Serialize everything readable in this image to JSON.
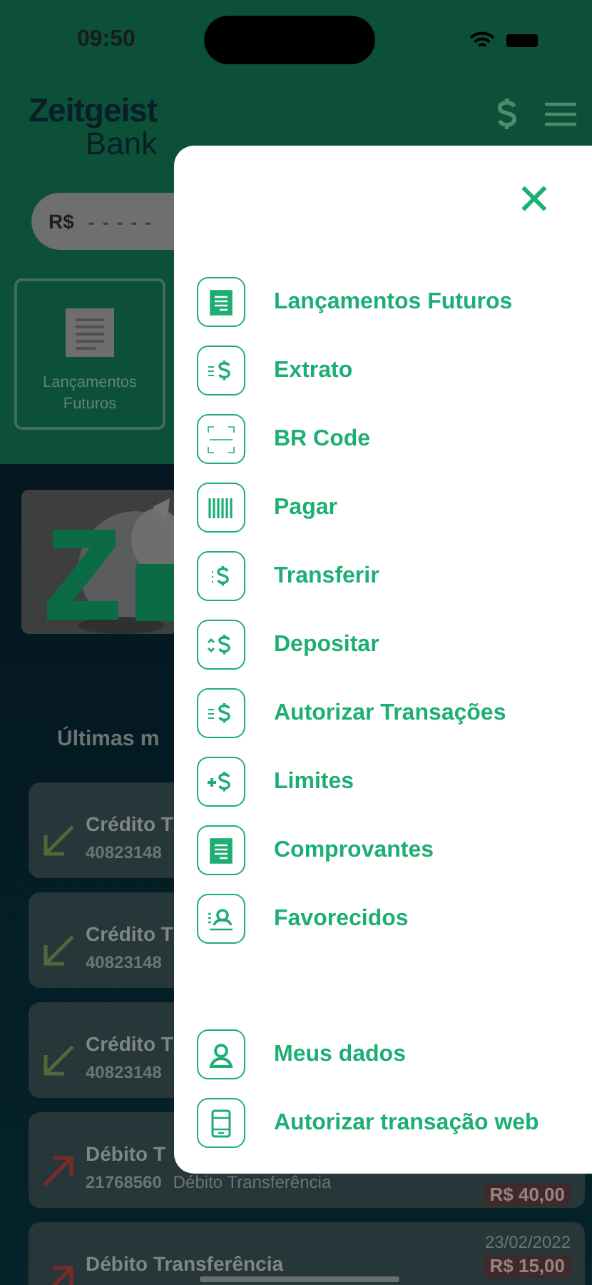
{
  "status_bar": {
    "time": "09:50"
  },
  "header": {
    "logo_top": "Zeitgeist",
    "logo_bottom": "Bank"
  },
  "balance": {
    "currency": "R$",
    "masked": "- - - - -"
  },
  "shortcut": {
    "label": "Lançamentos Futuros"
  },
  "recent": {
    "title": "Últimas m"
  },
  "transactions": [
    {
      "kind": "credit",
      "title": "Crédito T",
      "number": "40823148"
    },
    {
      "kind": "credit",
      "title": "Crédito T",
      "number": "40823148"
    },
    {
      "kind": "credit",
      "title": "Crédito T",
      "number": "40823148"
    },
    {
      "kind": "debit",
      "title": "Débito T",
      "number": "21768560",
      "description": "Débito Transferência",
      "amount": "R$ 40,00"
    },
    {
      "kind": "debit",
      "title": "Débito Transferência",
      "date": "23/02/2022",
      "amount": "R$ 15,00"
    }
  ],
  "menu": {
    "close": "✕",
    "items": [
      {
        "label": "Lançamentos Futuros"
      },
      {
        "label": "Extrato"
      },
      {
        "label": "BR Code"
      },
      {
        "label": "Pagar"
      },
      {
        "label": "Transferir"
      },
      {
        "label": "Depositar"
      },
      {
        "label": "Autorizar Transações"
      },
      {
        "label": "Limites"
      },
      {
        "label": "Comprovantes"
      },
      {
        "label": "Favorecidos"
      }
    ],
    "footer_items": [
      {
        "label": "Meus dados"
      },
      {
        "label": "Autorizar transação web"
      }
    ]
  }
}
